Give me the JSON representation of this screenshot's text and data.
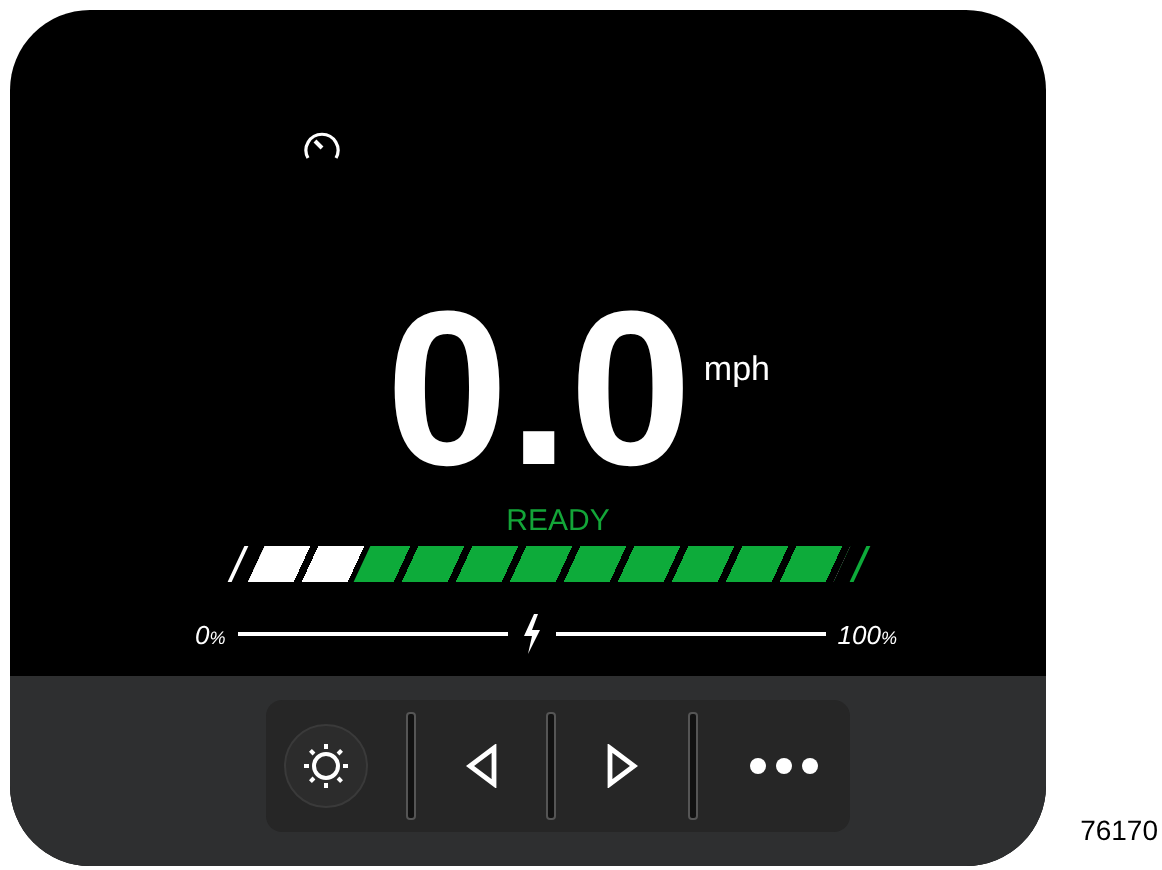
{
  "speed": {
    "value": "0.0",
    "unit": "mph"
  },
  "status": "READY",
  "battery": {
    "level": 0.82,
    "min_label": "0%",
    "max_label": "100%"
  },
  "toolbar": [
    {
      "kind": "brightness"
    },
    {
      "kind": "previous"
    },
    {
      "kind": "next"
    },
    {
      "kind": "more"
    }
  ],
  "figure_number": "76170"
}
